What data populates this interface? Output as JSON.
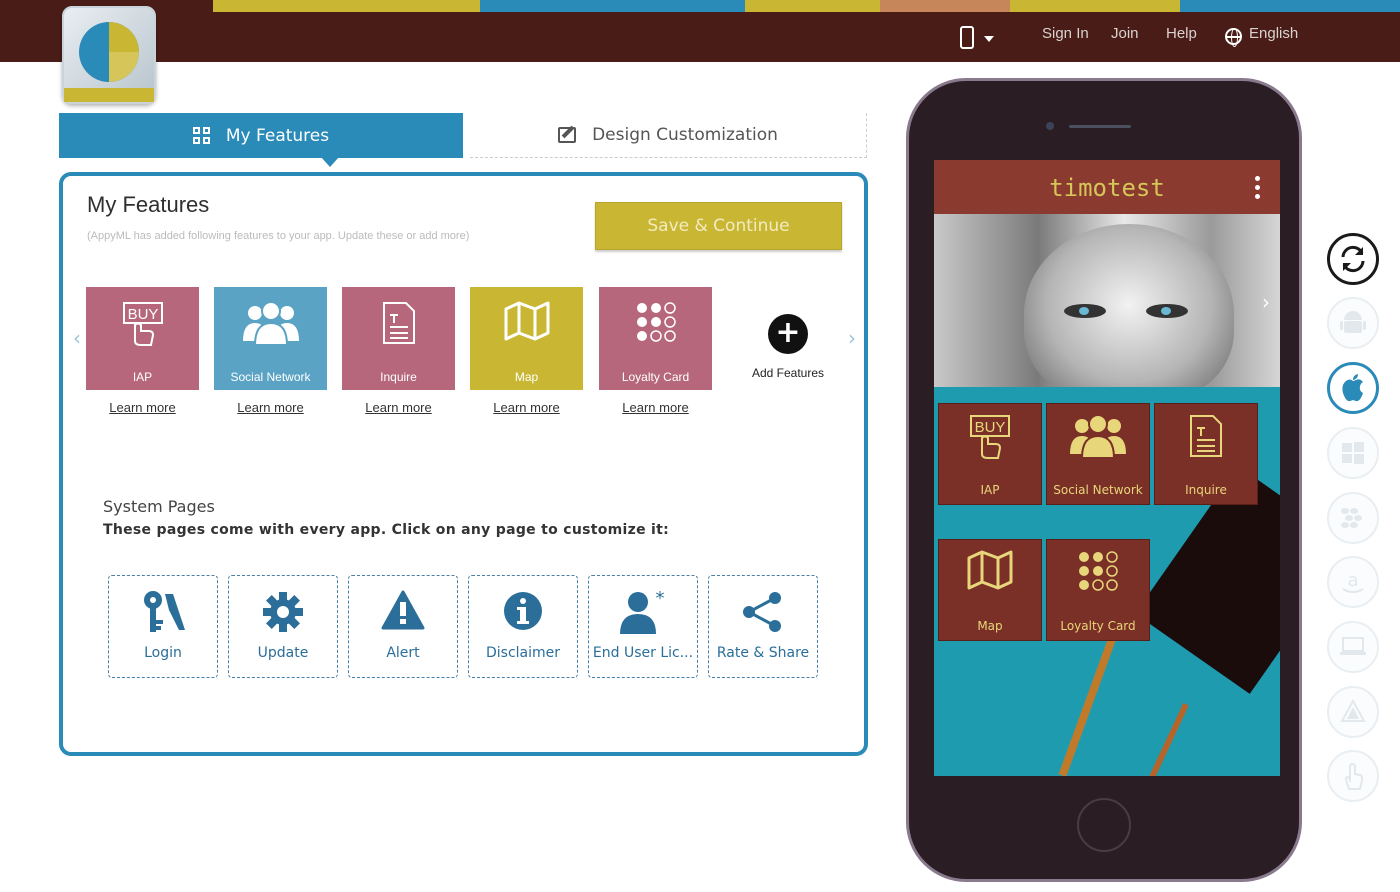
{
  "colors": {
    "topbar": "#4a1c17",
    "accent": "#2a8ab8",
    "save_button": "#c9b733",
    "feature_pink": "#b6677c",
    "feature_blue": "#5aa3c4",
    "feature_yellow": "#c9b733",
    "app_tile": "#7a2f27",
    "app_tile_text": "#e8d67a"
  },
  "header": {
    "device_icon": "mobile-phone-icon",
    "nav": {
      "sign_in": "Sign In",
      "join": "Join",
      "help": "Help",
      "language": "English"
    }
  },
  "tabs": [
    {
      "label": "My Features",
      "icon": "grid-icon",
      "active": true
    },
    {
      "label": "Design Customization",
      "icon": "edit-icon",
      "active": false
    }
  ],
  "panel": {
    "title": "My Features",
    "subtitle": "(AppyML has added following features to your app. Update these or add more)",
    "save_label": "Save & Continue",
    "features": [
      {
        "label": "IAP",
        "icon": "buy-icon",
        "learn": "Learn more"
      },
      {
        "label": "Social Network",
        "icon": "group-icon",
        "learn": "Learn more"
      },
      {
        "label": "Inquire",
        "icon": "document-icon",
        "learn": "Learn more"
      },
      {
        "label": "Map",
        "icon": "map-icon",
        "learn": "Learn more"
      },
      {
        "label": "Loyalty Card",
        "icon": "dots-grid-icon",
        "learn": "Learn more"
      }
    ],
    "add_features": "Add Features"
  },
  "system_pages": {
    "title": "System Pages",
    "subtitle": "These pages come with every app. Click on any page to customize it:",
    "items": [
      {
        "label": "Login",
        "icon": "key-icon"
      },
      {
        "label": "Update",
        "icon": "gear-icon"
      },
      {
        "label": "Alert",
        "icon": "warning-icon"
      },
      {
        "label": "Disclaimer",
        "icon": "info-icon"
      },
      {
        "label": "End User Lic...",
        "icon": "user-star-icon"
      },
      {
        "label": "Rate & Share",
        "icon": "share-icon"
      }
    ]
  },
  "preview": {
    "app_title": "timotest",
    "tiles": [
      {
        "label": "IAP"
      },
      {
        "label": "Social Network"
      },
      {
        "label": "Inquire"
      },
      {
        "label": "Map"
      },
      {
        "label": "Loyalty Card"
      }
    ]
  },
  "platforms": [
    {
      "icon": "refresh-icon",
      "state": "primary"
    },
    {
      "icon": "android-icon",
      "state": "disabled"
    },
    {
      "icon": "apple-icon",
      "state": "active"
    },
    {
      "icon": "windows-icon",
      "state": "disabled"
    },
    {
      "icon": "blackberry-icon",
      "state": "disabled"
    },
    {
      "icon": "amazon-icon",
      "state": "disabled"
    },
    {
      "icon": "desktop-icon",
      "state": "disabled"
    },
    {
      "icon": "triangle-logo-icon",
      "state": "disabled"
    },
    {
      "icon": "touch-icon",
      "state": "disabled"
    }
  ]
}
